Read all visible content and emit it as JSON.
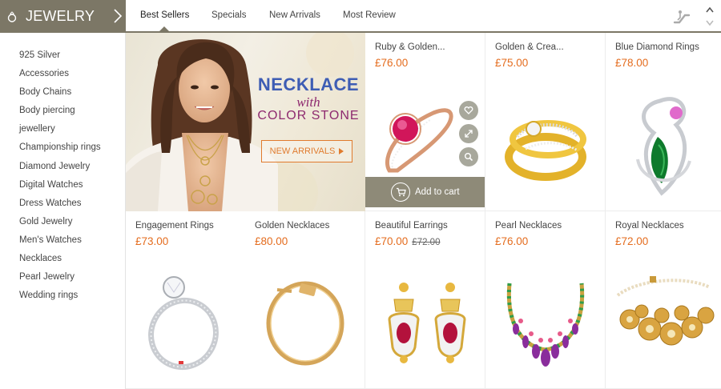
{
  "sidebar": {
    "title": "JEWELRY",
    "items": [
      {
        "label": "925 Silver"
      },
      {
        "label": "Accessories"
      },
      {
        "label": "Body Chains"
      },
      {
        "label": "Body piercing"
      },
      {
        "label": "jewellery"
      },
      {
        "label": "Championship rings"
      },
      {
        "label": "Diamond Jewelry"
      },
      {
        "label": "Digital Watches"
      },
      {
        "label": "Dress Watches"
      },
      {
        "label": "Gold Jewelry"
      },
      {
        "label": "Men's Watches"
      },
      {
        "label": "Necklaces"
      },
      {
        "label": "Pearl Jewelry"
      },
      {
        "label": "Wedding rings"
      }
    ]
  },
  "tabs": [
    {
      "label": "Best Sellers",
      "active": true
    },
    {
      "label": "Specials"
    },
    {
      "label": "New Arrivals"
    },
    {
      "label": "Most Review"
    }
  ],
  "banner": {
    "line1": "NECKLACE",
    "line2": "with",
    "line3": "COLOR STONE",
    "button": "NEW ARRIVALS"
  },
  "products": [
    {
      "name": "Ruby & Golden...",
      "price": "£76.00",
      "image": "ruby-ring-image",
      "hovered": true,
      "cart_label": "Add to cart"
    },
    {
      "name": "Golden & Crea...",
      "price": "£75.00",
      "image": "gold-ring-image"
    },
    {
      "name": "Blue Diamond Rings",
      "price": "£78.00",
      "image": "emerald-ring-image"
    },
    {
      "name": "Engagement Rings",
      "price": "£73.00",
      "image": "engagement-ring-image"
    },
    {
      "name": "Golden Necklaces",
      "price": "£80.00",
      "image": "nail-bracelet-image"
    },
    {
      "name": "Beautiful Earrings",
      "price": "£70.00",
      "old_price": "£72.00",
      "image": "earrings-image"
    },
    {
      "name": "Pearl Necklaces",
      "price": "£76.00",
      "image": "gem-necklace-image"
    },
    {
      "name": "Royal Necklaces",
      "price": "£72.00",
      "image": "gold-flower-bracelet-image"
    }
  ],
  "colors": {
    "accent": "#7c7766",
    "price": "#e46c1e",
    "banner_blue": "#3e5db4",
    "banner_purple": "#8e2a6f",
    "cart_bar": "#8e8a78"
  }
}
